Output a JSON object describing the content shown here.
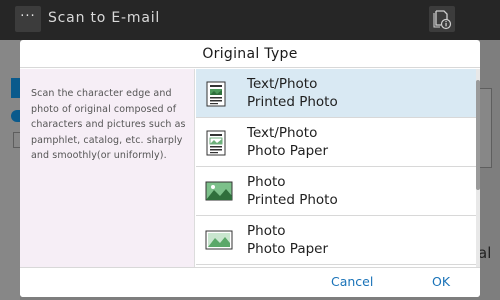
{
  "app": {
    "title": "Scan to E-mail",
    "menu_glyph": "···",
    "partial_right_label": "al"
  },
  "dialog": {
    "title": "Original Type",
    "description": "Scan the character edge and photo of original composed of characters and pictures such as pamphlet, catalog, etc. sharply and smoothly(or uniformly).",
    "items": [
      {
        "line1": "Text/Photo",
        "line2": "Printed Photo",
        "icon": "text-photo-printed-icon",
        "selected": true
      },
      {
        "line1": "Text/Photo",
        "line2": "Photo Paper",
        "icon": "text-photo-paper-icon",
        "selected": false
      },
      {
        "line1": "Photo",
        "line2": "Printed Photo",
        "icon": "photo-printed-icon",
        "selected": false
      },
      {
        "line1": "Photo",
        "line2": "Photo Paper",
        "icon": "photo-paper-icon",
        "selected": false
      }
    ],
    "cancel_label": "Cancel",
    "ok_label": "OK"
  },
  "colors": {
    "accent": "#1a73b8",
    "selected_row": "#d9e9f3",
    "description_panel": "#f6eef6",
    "top_bar": "#262626"
  }
}
